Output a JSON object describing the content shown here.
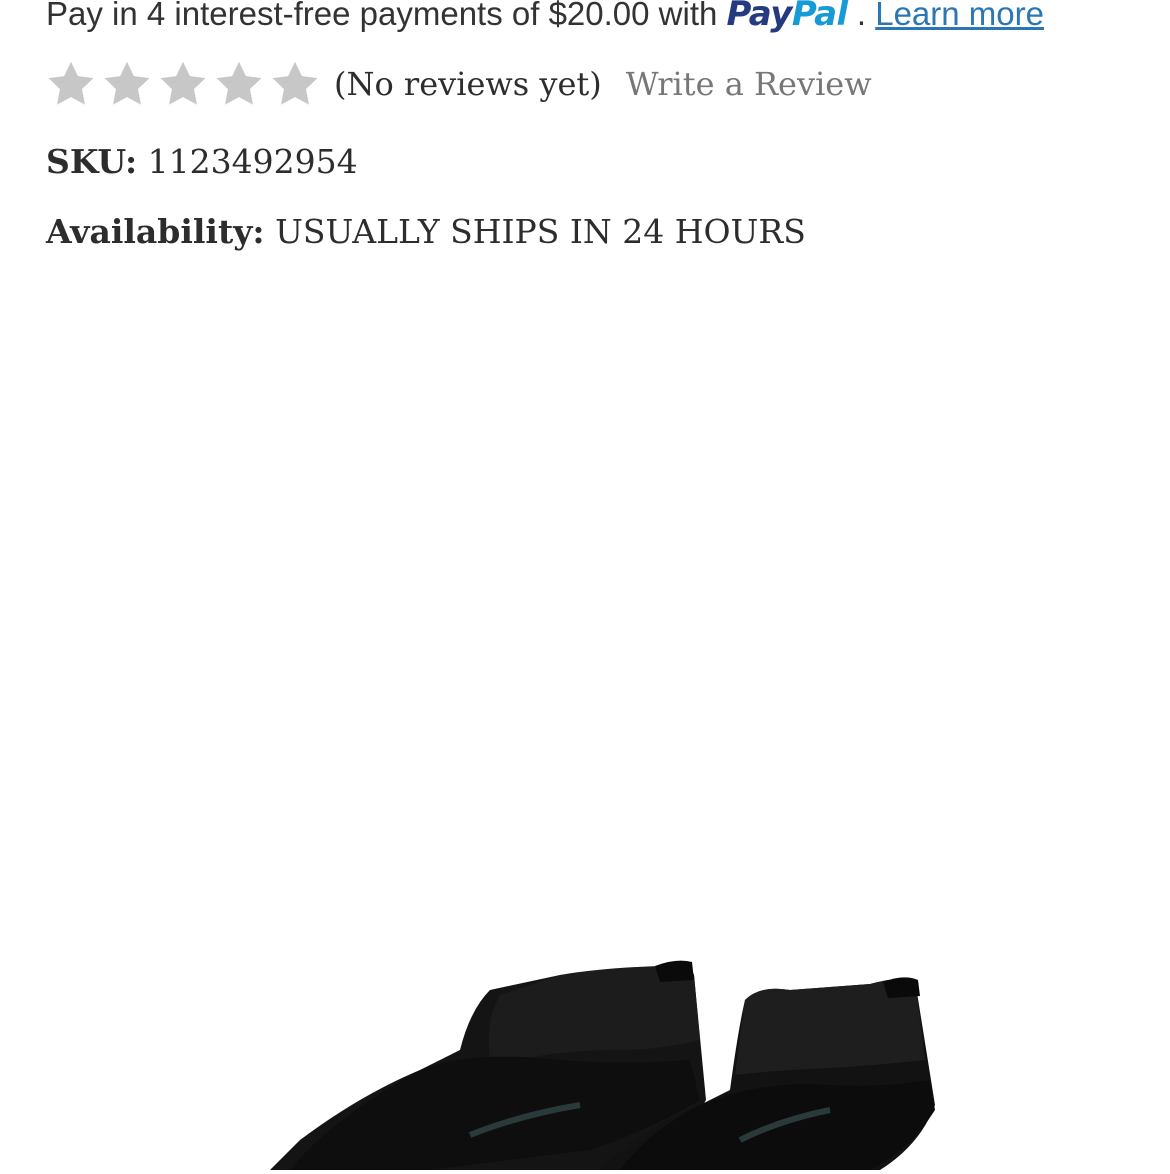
{
  "paypal": {
    "text_before": "Pay in 4 interest-free payments of $20.00 with",
    "logo_pay": "Pay",
    "logo_pal": "Pal",
    "separator": ".",
    "learn_more": "Learn more",
    "brand_dark": "#253b80",
    "brand_light": "#179bd7"
  },
  "rating": {
    "stars_filled": 0,
    "stars_total": 5,
    "review_count_text": "(No reviews yet)",
    "write_review": "Write a Review"
  },
  "product": {
    "sku_label": "SKU:",
    "sku_value": "1123492954",
    "availability_label": "Availability:",
    "availability_value": "USUALLY SHIPS IN 24 HOURS"
  },
  "image": {
    "icon": "black-soccer-boots-image"
  }
}
